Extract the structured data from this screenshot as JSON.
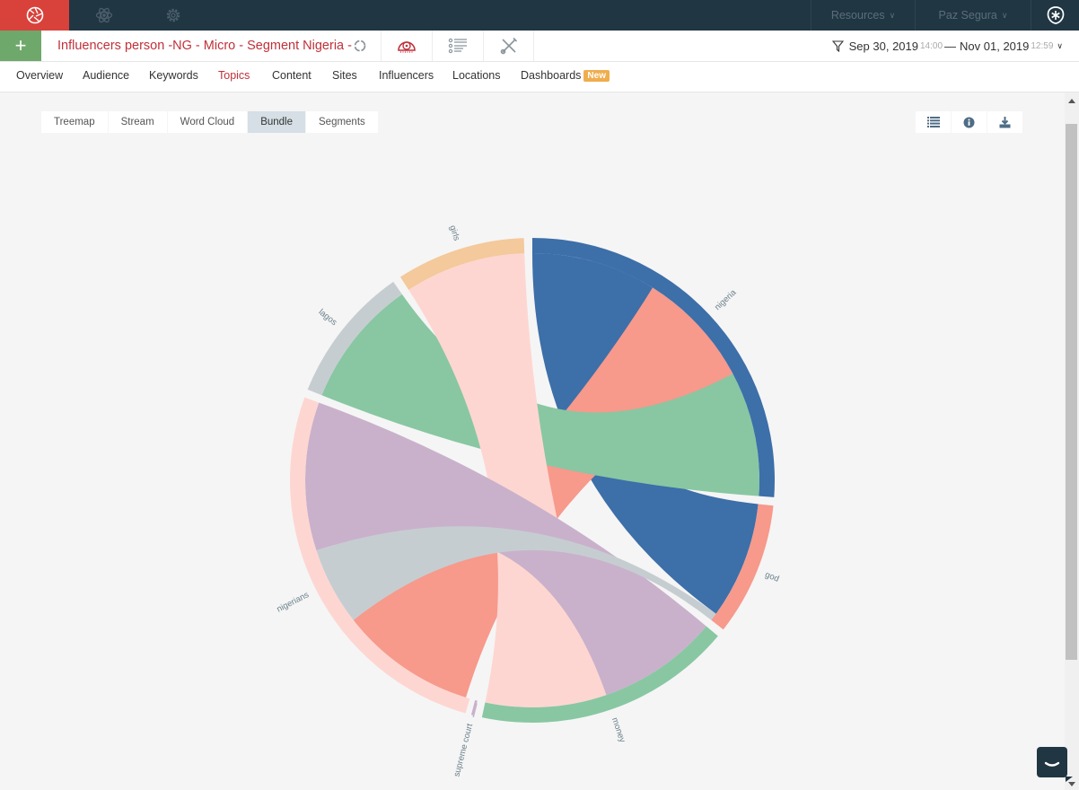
{
  "topbar": {
    "icons": [
      "aperture-logo-icon",
      "atom-icon",
      "gear-icon"
    ],
    "resources_label": "Resources",
    "user_label": "Paz Segura",
    "avatar_icon": "asterisk-badge-icon"
  },
  "subbar": {
    "add_label": "+",
    "query_title": "Influencers person -NG - Micro - Segment Nigeria -",
    "tools": [
      "refresh-icon",
      "dashboard-gauge-icon",
      "list-icon",
      "tools-icon"
    ],
    "date_start": "Sep 30, 2019",
    "time_start": "14:00",
    "separator": "—",
    "date_end": "Nov 01, 2019",
    "time_end": "12:59"
  },
  "nav": {
    "items": [
      {
        "label": "Overview"
      },
      {
        "label": "Audience"
      },
      {
        "label": "Keywords"
      },
      {
        "label": "Topics",
        "active": true
      },
      {
        "label": "Content"
      },
      {
        "label": "Sites"
      },
      {
        "label": "Influencers"
      },
      {
        "label": "Locations"
      },
      {
        "label": "Dashboards",
        "badge": "New"
      }
    ]
  },
  "view_tabs": {
    "items": [
      "Treemap",
      "Stream",
      "Word Cloud",
      "Bundle",
      "Segments"
    ],
    "active": "Bundle"
  },
  "chart_tools": [
    "list-icon",
    "info-icon",
    "download-icon"
  ],
  "chart_data": {
    "type": "chord",
    "title": "",
    "groups": [
      {
        "name": "nigeria",
        "color": "#3d6fa9",
        "start": 0,
        "end": 94
      },
      {
        "name": "god",
        "color": "#f7998b",
        "start": 96,
        "end": 128
      },
      {
        "name": "money",
        "color": "#88c7a2",
        "start": 130,
        "end": 192
      },
      {
        "name": "supreme court",
        "color": "#c9b1cb",
        "start": 194,
        "end": 194.6
      },
      {
        "name": "nigerians",
        "color": "#fed6d1",
        "start": 196,
        "end": 290
      },
      {
        "name": "lagos",
        "color": "#c6cdd1",
        "start": 292,
        "end": 325
      },
      {
        "name": "girls",
        "color": "#f4c99b",
        "start": 327,
        "end": 358
      }
    ],
    "chords": [
      {
        "source": "nigeria",
        "target": "god",
        "color": "#3d6fa9",
        "s": [
          0,
          32
        ],
        "t": [
          96,
          126
        ]
      },
      {
        "source": "nigeria",
        "target": "nigerians",
        "color": "#f7998b",
        "s": [
          32,
          62
        ],
        "t": [
          197,
          232
        ]
      },
      {
        "source": "nigeria",
        "target": "lagos",
        "color": "#88c7a2",
        "s": [
          62,
          94
        ],
        "t": [
          292,
          325
        ]
      },
      {
        "source": "girls",
        "target": "money",
        "color": "#fed6d1",
        "s": [
          327,
          358
        ],
        "t": [
          161,
          192
        ]
      },
      {
        "source": "nigerians",
        "target": "money",
        "color": "#c9b1cb",
        "s": [
          252,
          290
        ],
        "t": [
          130,
          161
        ]
      },
      {
        "source": "nigerians",
        "target": "god",
        "color": "#c6cdd1",
        "s": [
          232,
          252
        ],
        "t": [
          126,
          128
        ]
      }
    ]
  }
}
